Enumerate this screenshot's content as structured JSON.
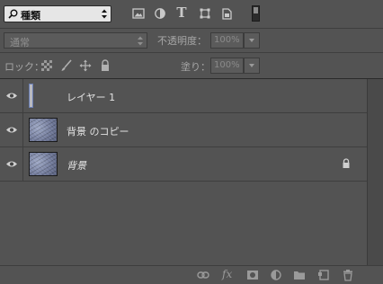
{
  "filter": {
    "kind_label": "種類",
    "icons": [
      "image-filter-icon",
      "adjustment-filter-icon",
      "type-filter-icon",
      "shape-filter-icon",
      "smart-object-filter-icon"
    ],
    "text_icon_glyph": "T"
  },
  "blend": {
    "mode": "通常",
    "opacity_label": "不透明度：",
    "opacity_value": "100%"
  },
  "lock": {
    "label": "ロック：",
    "fill_label": "塗り：",
    "fill_value": "100%"
  },
  "layers": [
    {
      "name": "レイヤー 1",
      "visible": true,
      "locked": false,
      "italic": false
    },
    {
      "name": "背景 のコピー",
      "visible": true,
      "locked": false,
      "italic": false
    },
    {
      "name": "背景",
      "visible": true,
      "locked": true,
      "italic": true
    }
  ],
  "bottom": {
    "fx_label": "fx"
  },
  "colors": {
    "panel_bg": "#535353",
    "divider": "#3e3e3e",
    "text": "#e2e2e2",
    "dim_text": "#8a8a8a",
    "selected_blue": "#6a7db2"
  }
}
